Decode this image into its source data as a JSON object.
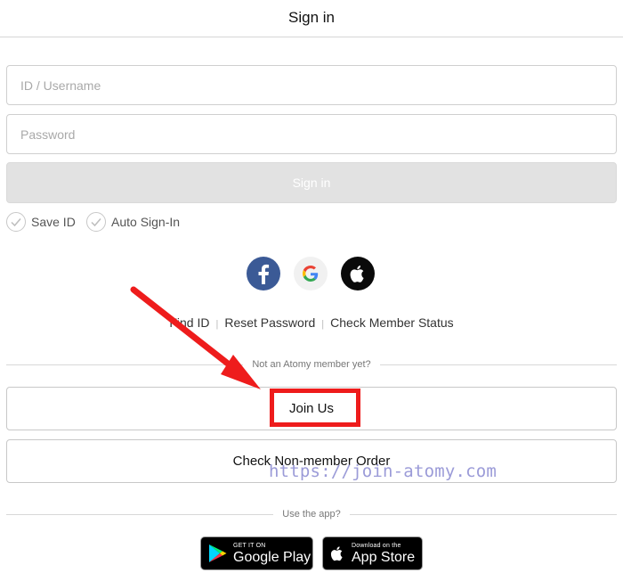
{
  "header": {
    "title": "Sign in"
  },
  "form": {
    "id_placeholder": "ID / Username",
    "password_placeholder": "Password",
    "signin_label": "Sign in",
    "save_id_label": "Save ID",
    "auto_signin_label": "Auto Sign-In"
  },
  "social": [
    {
      "name": "facebook-icon",
      "glyph": "f"
    },
    {
      "name": "google-icon",
      "glyph": "G"
    },
    {
      "name": "apple-icon",
      "glyph": "apple"
    }
  ],
  "links": {
    "find_id": "Find ID",
    "reset_password": "Reset Password",
    "check_member_status": "Check Member Status",
    "separator": "|"
  },
  "member_prompt": "Not an Atomy member yet?",
  "join_us_label": "Join Us",
  "non_member_order_label": "Check Non-member Order",
  "watermark": "https://join-atomy.com",
  "app_prompt": "Use the app?",
  "stores": {
    "google_play": {
      "small": "GET IT ON",
      "big": "Google Play"
    },
    "app_store": {
      "small": "Download on the",
      "big": "App Store"
    }
  },
  "colors": {
    "facebook": "#3b5a96",
    "annotation_red": "#ee1c1c",
    "watermark": "#9b9bd8",
    "signin_disabled": "#e2e2e2"
  }
}
